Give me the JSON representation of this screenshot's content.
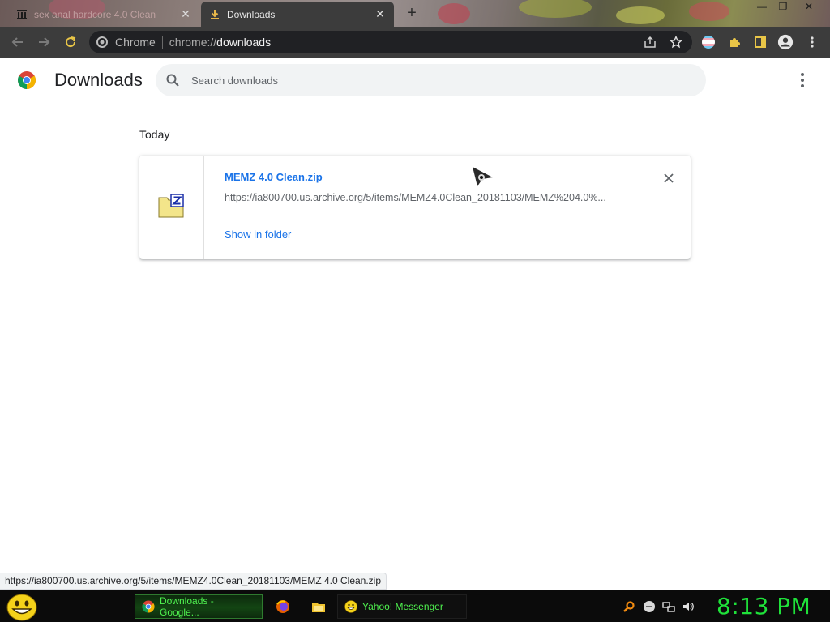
{
  "browser": {
    "tabs": [
      {
        "title": "sex anal hardcore 4.0 Clean",
        "active": false
      },
      {
        "title": "Downloads",
        "active": true
      }
    ],
    "new_tab_label": "+",
    "omnibox": {
      "chip_label": "Chrome",
      "scheme": "chrome://",
      "host": "downloads"
    }
  },
  "downloads_page": {
    "title": "Downloads",
    "search": {
      "placeholder": "Search downloads",
      "value": ""
    },
    "sections": [
      {
        "date_label": "Today",
        "items": [
          {
            "file_name": "MEMZ 4.0 Clean.zip",
            "url": "https://ia800700.us.archive.org/5/items/MEMZ4.0Clean_20181103/MEMZ%204.0%...",
            "action_label": "Show in folder"
          }
        ]
      }
    ]
  },
  "status_bar": {
    "url": "https://ia800700.us.archive.org/5/items/MEMZ4.0Clean_20181103/MEMZ 4.0 Clean.zip"
  },
  "taskbar": {
    "tasks": [
      {
        "label": "Downloads - Google...",
        "icon": "chrome-icon",
        "active": true
      },
      {
        "label": "Yahoo! Messenger",
        "icon": "yahoo-messenger-icon",
        "active": false
      }
    ],
    "clock": "8:13 PM"
  },
  "colors": {
    "accent_blue": "#1a73e8",
    "toolbar": "#3c3c3c",
    "clock_green": "#1fe23a",
    "taskbar_text_green": "#4ff24f"
  }
}
